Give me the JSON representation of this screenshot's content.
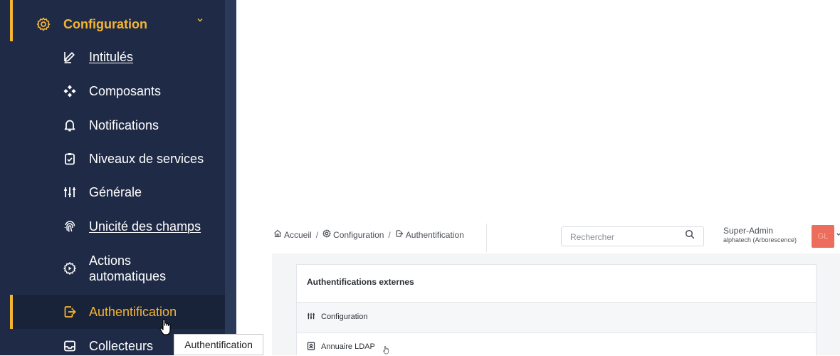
{
  "sidebar": {
    "section": {
      "label": "Configuration",
      "icon": "gear-icon",
      "chevron": "⌄"
    },
    "items": [
      {
        "label": "Intitulés",
        "icon": "edit-icon",
        "glyph": "✎"
      },
      {
        "label": "Composants",
        "icon": "components-icon",
        "glyph": "❖"
      },
      {
        "label": "Notifications",
        "icon": "bell-icon",
        "glyph": "♫"
      },
      {
        "label": "Niveaux de services",
        "icon": "clipboard-icon",
        "glyph": "▣"
      },
      {
        "label": "Générale",
        "icon": "sliders-icon",
        "glyph": "⚙"
      },
      {
        "label": "Unicité des champs",
        "icon": "fingerprint-icon",
        "glyph": "◎"
      },
      {
        "label_line1": "Actions",
        "label_line2": "automatiques",
        "icon": "automation-icon",
        "glyph": "⚙"
      },
      {
        "label": "Authentification",
        "icon": "login-icon",
        "glyph": "⇥",
        "active": true
      },
      {
        "label": "Collecteurs",
        "icon": "inbox-icon",
        "glyph": "☐"
      }
    ],
    "tooltip": "Authentification"
  },
  "breadcrumb": {
    "home": "Accueil",
    "config": "Configuration",
    "current": "Authentification",
    "separator": "/"
  },
  "search": {
    "placeholder": "Rechercher"
  },
  "user": {
    "name": "Super-Admin",
    "org": "alphatech (Arborescence)",
    "initials": "GL"
  },
  "card": {
    "title": "Authentifications externes",
    "rows": [
      {
        "label": "Configuration",
        "icon": "sliders-icon"
      },
      {
        "label": "Annuaire LDAP",
        "icon": "directory-icon"
      }
    ]
  },
  "colors": {
    "sidebar_bg": "#1f2b46",
    "accent": "#f5b531",
    "avatar_bg": "#ec6d5b",
    "content_bg": "#f4f5f7"
  }
}
